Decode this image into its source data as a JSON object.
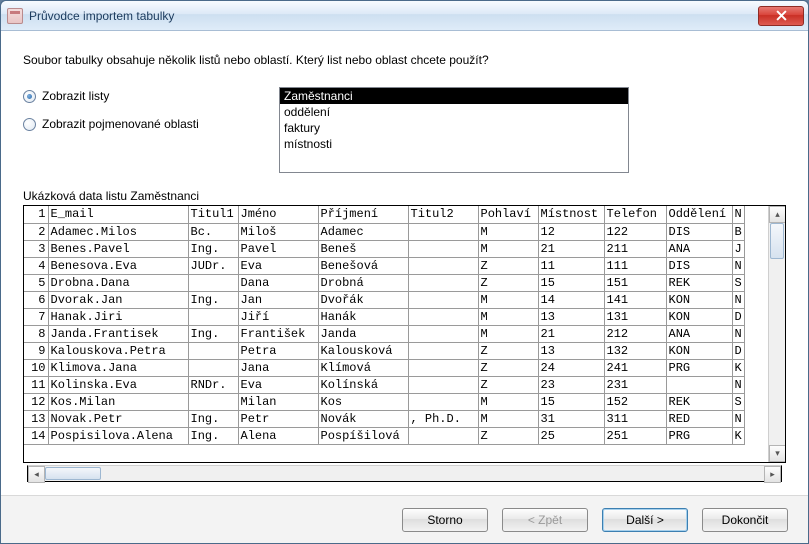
{
  "window": {
    "title": "Průvodce importem tabulky"
  },
  "prompt": "Soubor tabulky obsahuje několik listů nebo oblastí. Který list nebo oblast chcete použít?",
  "radios": {
    "show_sheets": "Zobrazit listy",
    "show_named_ranges": "Zobrazit pojmenované oblasti",
    "selected": "show_sheets"
  },
  "listbox": {
    "items": [
      "Zaměstnanci",
      "oddělení",
      "faktury",
      "místnosti"
    ],
    "selected_index": 0
  },
  "preview_label": "Ukázková data listu Zaměstnanci",
  "columns": [
    "E_mail",
    "Titul1",
    "Jméno",
    "Příjmení",
    "Titul2",
    "Pohlaví",
    "Místnost",
    "Telefon",
    "Oddělení",
    "N"
  ],
  "rows": [
    {
      "n": 1,
      "email": "E_mail",
      "tit1": "Titul1",
      "jmeno": "Jméno",
      "pri": "Příjmení",
      "tit2": "Titul2",
      "pohl": "Pohlaví",
      "mist": "Místnost",
      "tel": "Telefon",
      "odd": "Oddělení",
      "last": "N"
    },
    {
      "n": 2,
      "email": "Adamec.Milos",
      "tit1": "Bc.",
      "jmeno": "Miloš",
      "pri": "Adamec",
      "tit2": "",
      "pohl": "M",
      "mist": "12",
      "tel": "122",
      "odd": "DIS",
      "last": "B"
    },
    {
      "n": 3,
      "email": "Benes.Pavel",
      "tit1": "Ing.",
      "jmeno": "Pavel",
      "pri": "Beneš",
      "tit2": "",
      "pohl": "M",
      "mist": "21",
      "tel": "211",
      "odd": "ANA",
      "last": "J"
    },
    {
      "n": 4,
      "email": "Benesova.Eva",
      "tit1": "JUDr.",
      "jmeno": "Eva",
      "pri": "Benešová",
      "tit2": "",
      "pohl": "Z",
      "mist": "11",
      "tel": "111",
      "odd": "DIS",
      "last": "N"
    },
    {
      "n": 5,
      "email": "Drobna.Dana",
      "tit1": "",
      "jmeno": "Dana",
      "pri": "Drobná",
      "tit2": "",
      "pohl": "Z",
      "mist": "15",
      "tel": "151",
      "odd": "REK",
      "last": "S"
    },
    {
      "n": 6,
      "email": "Dvorak.Jan",
      "tit1": "Ing.",
      "jmeno": "Jan",
      "pri": "Dvořák",
      "tit2": "",
      "pohl": "M",
      "mist": "14",
      "tel": "141",
      "odd": "KON",
      "last": "N"
    },
    {
      "n": 7,
      "email": "Hanak.Jiri",
      "tit1": "",
      "jmeno": "Jiří",
      "pri": "Hanák",
      "tit2": "",
      "pohl": "M",
      "mist": "13",
      "tel": "131",
      "odd": "KON",
      "last": "D"
    },
    {
      "n": 8,
      "email": "Janda.Frantisek",
      "tit1": "Ing.",
      "jmeno": "František",
      "pri": "Janda",
      "tit2": "",
      "pohl": "M",
      "mist": "21",
      "tel": "212",
      "odd": "ANA",
      "last": "N"
    },
    {
      "n": 9,
      "email": "Kalouskova.Petra",
      "tit1": "",
      "jmeno": "Petra",
      "pri": "Kalousková",
      "tit2": "",
      "pohl": "Z",
      "mist": "13",
      "tel": "132",
      "odd": "KON",
      "last": "D"
    },
    {
      "n": 10,
      "email": "Klimova.Jana",
      "tit1": "",
      "jmeno": "Jana",
      "pri": "Klímová",
      "tit2": "",
      "pohl": "Z",
      "mist": "24",
      "tel": "241",
      "odd": "PRG",
      "last": "K"
    },
    {
      "n": 11,
      "email": "Kolinska.Eva",
      "tit1": "RNDr.",
      "jmeno": "Eva",
      "pri": "Kolínská",
      "tit2": "",
      "pohl": "Z",
      "mist": "23",
      "tel": "231",
      "odd": "",
      "last": "N"
    },
    {
      "n": 12,
      "email": "Kos.Milan",
      "tit1": "",
      "jmeno": "Milan",
      "pri": "Kos",
      "tit2": "",
      "pohl": "M",
      "mist": "15",
      "tel": "152",
      "odd": "REK",
      "last": "S"
    },
    {
      "n": 13,
      "email": "Novak.Petr",
      "tit1": "Ing.",
      "jmeno": "Petr",
      "pri": "Novák",
      "tit2": ", Ph.D.",
      "pohl": "M",
      "mist": "31",
      "tel": "311",
      "odd": "RED",
      "last": "N"
    },
    {
      "n": 14,
      "email": "Pospisilova.Alena",
      "tit1": "Ing.",
      "jmeno": "Alena",
      "pri": "Pospíšilová",
      "tit2": "",
      "pohl": "Z",
      "mist": "25",
      "tel": "251",
      "odd": "PRG",
      "last": "K"
    }
  ],
  "buttons": {
    "cancel": "Storno",
    "back": "< Zpět",
    "next": "Další >",
    "finish": "Dokončit"
  }
}
